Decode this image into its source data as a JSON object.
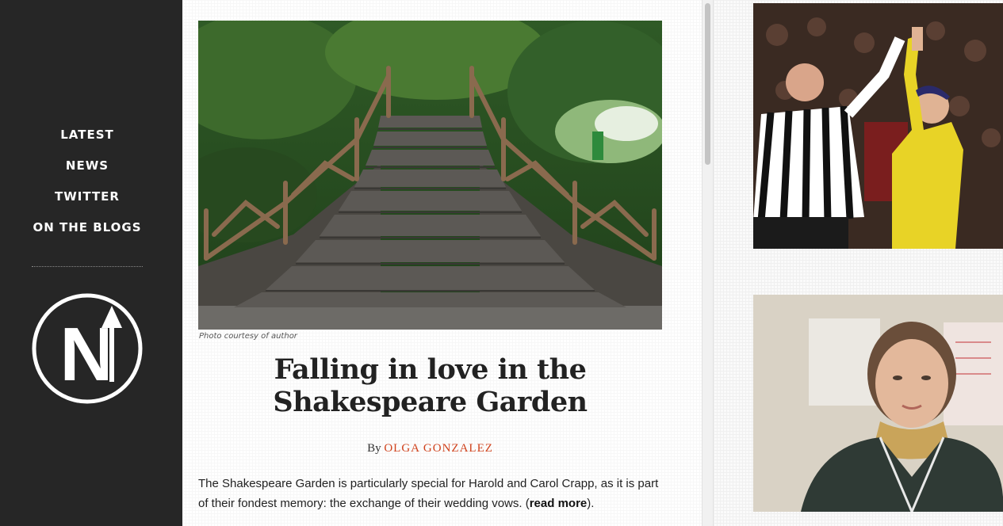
{
  "nav": {
    "items": [
      {
        "label": "LATEST"
      },
      {
        "label": "NEWS"
      },
      {
        "label": "TWITTER"
      },
      {
        "label": "ON THE BLOGS"
      }
    ]
  },
  "logo": {
    "letter": "N"
  },
  "article": {
    "photo_caption": "Photo courtesy of author",
    "title": "Falling in love in the Shakespeare Garden",
    "byline_prefix": "By",
    "author": "OLGA GONZALEZ",
    "excerpt": "The Shakespeare Garden is particularly special for Harold and Carol Crapp, as it is part of their fondest memory: the exchange of their wedding vows. (",
    "read_more": "read more",
    "excerpt_end": ")."
  },
  "colors": {
    "sidebar_bg": "#262626",
    "author_link": "#d0421c"
  }
}
